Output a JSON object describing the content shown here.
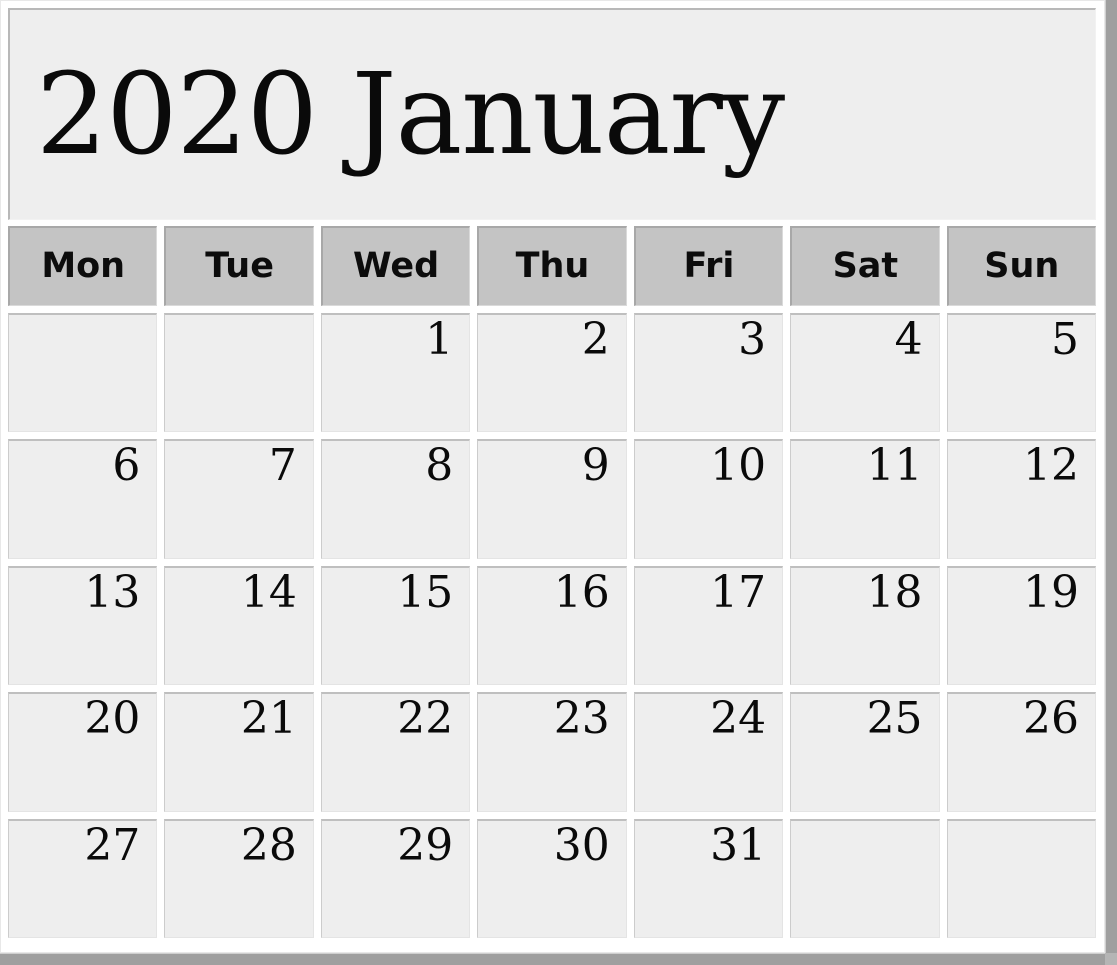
{
  "calendar": {
    "title": "2020 January",
    "year": "2020",
    "month": "January",
    "weekday_headers": [
      "Mon",
      "Tue",
      "Wed",
      "Thu",
      "Fri",
      "Sat",
      "Sun"
    ],
    "weeks": [
      [
        "",
        "",
        "1",
        "2",
        "3",
        "4",
        "5"
      ],
      [
        "6",
        "7",
        "8",
        "9",
        "10",
        "11",
        "12"
      ],
      [
        "13",
        "14",
        "15",
        "16",
        "17",
        "18",
        "19"
      ],
      [
        "20",
        "21",
        "22",
        "23",
        "24",
        "25",
        "26"
      ],
      [
        "27",
        "28",
        "29",
        "30",
        "31",
        "",
        ""
      ]
    ],
    "colors": {
      "page_background": "#ffffff",
      "title_background": "#eeeeee",
      "weekday_header_background": "#c4c4c4",
      "day_cell_background": "#eeeeee",
      "text": "#0a0a0a",
      "cell_border": "#bfbfbf",
      "scrollbar": "#9f9f9f"
    }
  }
}
